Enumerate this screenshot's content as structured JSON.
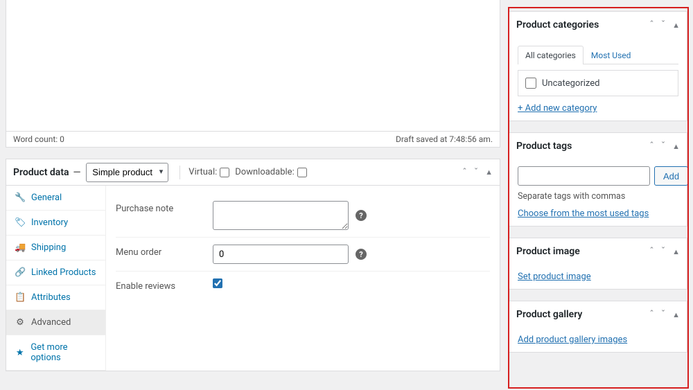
{
  "editor": {
    "word_count_label": "Word count: 0",
    "draft_status": "Draft saved at 7:48:56 am."
  },
  "product_data": {
    "title": "Product data",
    "dash": "—",
    "type_selected": "Simple product",
    "virtual_label": "Virtual:",
    "downloadable_label": "Downloadable:",
    "tabs": {
      "general": "General",
      "inventory": "Inventory",
      "shipping": "Shipping",
      "linked": "Linked Products",
      "attributes": "Attributes",
      "advanced": "Advanced",
      "more": "Get more options"
    },
    "fields": {
      "purchase_note_label": "Purchase note",
      "menu_order_label": "Menu order",
      "menu_order_value": "0",
      "enable_reviews_label": "Enable reviews"
    }
  },
  "sidebar": {
    "categories": {
      "title": "Product categories",
      "tab_all": "All categories",
      "tab_most": "Most Used",
      "items": [
        "Uncategorized"
      ],
      "add_new": "+ Add new category"
    },
    "tags": {
      "title": "Product tags",
      "add_btn": "Add",
      "hint": "Separate tags with commas",
      "choose": "Choose from the most used tags"
    },
    "image": {
      "title": "Product image",
      "link": "Set product image"
    },
    "gallery": {
      "title": "Product gallery",
      "link": "Add product gallery images"
    }
  }
}
